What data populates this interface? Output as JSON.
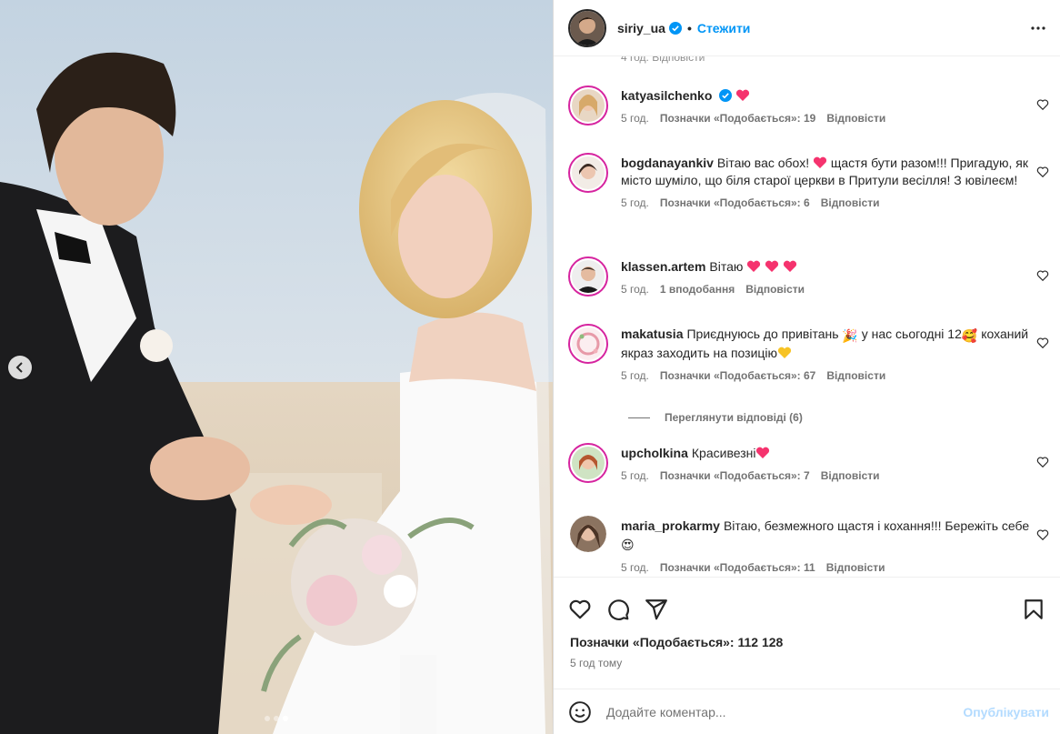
{
  "post": {
    "username": "siriy_ua",
    "separator": "•",
    "follow_label": "Стежити",
    "carousel": {
      "total": 3,
      "active": 3
    }
  },
  "comments": [
    {
      "username": "katyasilchenko",
      "verified": true,
      "text": "",
      "emoji": "heart",
      "time": "5 год.",
      "likes": "Позначки «Подобається»: 19",
      "reply": "Відповісти"
    },
    {
      "username": "bogdanayankiv",
      "text_a": "Вітаю вас обох!",
      "text_b": "щастя бути разом!!! Пригадую, як місто шуміло, що біля старої церкви в Притули весілля! З ювілеєм!",
      "time": "5 год.",
      "likes": "Позначки «Подобається»: 6",
      "reply": "Відповісти"
    },
    {
      "username": "klassen.artem",
      "text": "Вітаю",
      "time": "5 год.",
      "likes": "1 вподобання",
      "reply": "Відповісти"
    },
    {
      "username": "makatusia",
      "text_a": "Приєднуюсь до привітань",
      "text_b": "у нас сьогодні 12",
      "text_c": "коханий якраз заходить на позицію",
      "time": "5 год.",
      "likes": "Позначки «Подобається»: 67",
      "reply": "Відповісти"
    },
    {
      "username": "upcholkina",
      "text": "Красивезні",
      "time": "5 год.",
      "likes": "Позначки «Подобається»: 7",
      "reply": "Відповісти"
    },
    {
      "username": "maria_prokarmy",
      "text_a": "Вітаю, безмежного щастя і кохання!!! Бережіть себе",
      "time": "5 год.",
      "likes": "Позначки «Подобається»: 11",
      "reply": "Відповісти"
    }
  ],
  "view_replies": "Переглянути відповіді (6)",
  "ghost_row": "4 год.    Відповісти",
  "likes_total": "Позначки «Подобається»: 112 128",
  "posted_ago": "5 год тому",
  "add_comment": {
    "placeholder": "Додайте коментар...",
    "post_label": "Опублікувати"
  },
  "colors": {
    "accent": "#0095f6",
    "heart": "#ff3040",
    "text": "#262626",
    "muted": "#737373"
  }
}
